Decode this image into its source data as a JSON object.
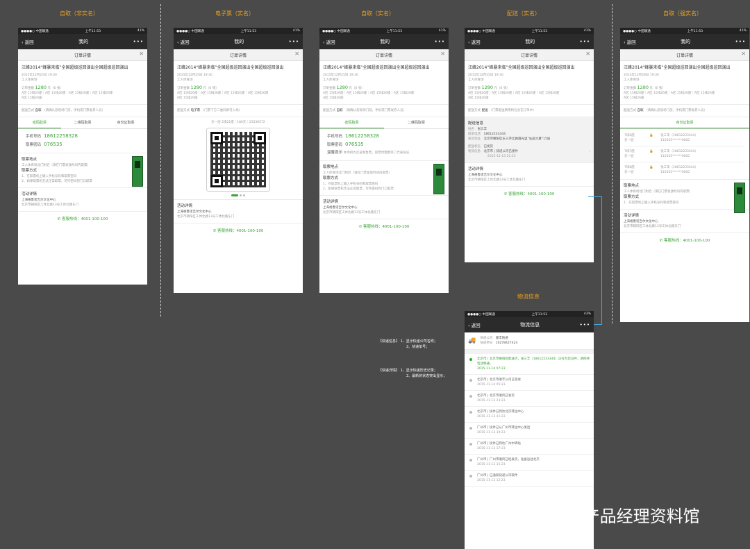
{
  "columns": [
    "自取（非实名）",
    "电子票（实名）",
    "自取（实名）",
    "配送（实名）",
    "自取（强实名）",
    "物流信息"
  ],
  "status": {
    "carrier": "●●●●○ 中国联通",
    "time": "上午11:53",
    "battery": "41%",
    "battery2": "43%"
  },
  "nav": {
    "back": "返回",
    "title": "我的",
    "logistics_title": "物流信息",
    "more": "•••"
  },
  "sub_title": "订单详情",
  "event": {
    "title": "汪峰2014“峰暴来临”全国超级巡回演出全国超级巡回演出",
    "title_alt": "汪峰2014“峰暴来临”全国超级巡回演出全国超级巡回演出",
    "date": "2015年12月25日 19:30",
    "date_alt": "2014年12月28日 19:30",
    "venue": "工人体育场",
    "amount_label": "订单金额",
    "amount": "1280",
    "amount_unit": "元（6 张）",
    "seats": "A区 15排26座｜A区 15排26座｜A区 15排26座｜A区 15排26座",
    "seats2": "A区 15排26座"
  },
  "delivery": {
    "label": "配送方式",
    "self": "自取",
    "self_hint": "（请确认您现场门前，手机或门票发券人员）",
    "eticket": "电子票",
    "eticket_hint": "（门票下方二维码即可入场）",
    "ship": "配送",
    "ship_hint": "（门票配送费用将包含在订单中）"
  },
  "tabs": {
    "a": "密码取票",
    "b": "二维码取票",
    "c": "身份证取票"
  },
  "code": {
    "phone_label": "手机号码",
    "phone": "18612258328",
    "pwd_label": "取票密码",
    "pwd": "076535",
    "tip_label": "温馨提示",
    "tip": "本项目为实名制售票，取票时需携带二代身份证"
  },
  "pickup": {
    "place_label": "取票地点",
    "place": "工人体育场北门附近（请在门票发放时间内取票）",
    "method_label": "取票方式",
    "method1": "1、在取票机上输入手机号码和取票密码",
    "method2": "2、如果取票机无法正常取票，可凭密码到门口取票"
  },
  "qr": {
    "hint": "东一层 2排21座｜180元｜23536572"
  },
  "organizer": {
    "label": "活动详情",
    "name": "上海格鲁诺吉尔文化中心",
    "addr": "北京市朝阳区工体北路13号工体北路东门"
  },
  "hotline": "客服热线：4001-100-100",
  "ship_info": {
    "label": "配送信息",
    "contact_label": "姓名",
    "contact": "张三丰",
    "phone_label": "联系电话",
    "phone": "18612233344",
    "addr_label": "收货地址",
    "addr": "北京市朝阳区东三环北路霞光里“弘毅大厦”15层",
    "status_label": "配送状态",
    "status": "已发货",
    "express_label": "物流信息",
    "express": "北京市 | 快递公司已接件",
    "express_time": "2015-11-13 21:23"
  },
  "strong": {
    "tab": "身份证取票",
    "items": [
      {
        "seat": "7排6座",
        "zone": "东一层",
        "name": "张三丰",
        "phone": "18612233344",
        "id": "110105******0000"
      },
      {
        "seat": "7排7座",
        "zone": "东一层",
        "name": "张三丰",
        "phone": "18612233344",
        "id": "110105******0000"
      },
      {
        "seat": "7排8座",
        "zone": "东一层",
        "name": "张三丰",
        "phone": "18612233344",
        "id": "110105******0000"
      }
    ]
  },
  "logistics": {
    "company_label": "快递公司",
    "company": "顺丰快递",
    "no_label": "快递单号",
    "no": "10278427424",
    "items": [
      {
        "text": "北京市 | 北京市朝阳区配送点，张三丰（18612233344）正在为您派件，请保持电话畅通。",
        "time": "2015-11-14 07:23"
      },
      {
        "text": "北京市 | 北京市顺丰公司已签收",
        "time": "2015-11-14 05:23"
      },
      {
        "text": "北京市 | 北京市顺风已发货",
        "time": "2015-11-13 23:23"
      },
      {
        "text": "北京市 | 快件已到达北京转运中心",
        "time": "2015-11-13 21:23"
      },
      {
        "text": "广州市 | 快件已从广州市转运中心发出",
        "time": "2015-11-13 19:23"
      },
      {
        "text": "广州市 | 快件已到达广州中转站",
        "time": "2015-11-13 17:23"
      },
      {
        "text": "广州市 | 广州市顺风已经发货，准备运往北京",
        "time": "2015-11-13 15:23"
      },
      {
        "text": "广州市 | 已通知快递公司取件",
        "time": "2015-11-13 12:23"
      }
    ]
  },
  "notes": {
    "n1_label": "【快递信息】",
    "n1_line1": "1、显示快递公司名称；",
    "n1_line2": "2、快递单号；",
    "n2_label": "【快递详情】",
    "n2_line1": "1、显示快递历史记录；",
    "n2_line2": "2、最新的状态突出显示；"
  },
  "watermark": "产品经理资料馆"
}
